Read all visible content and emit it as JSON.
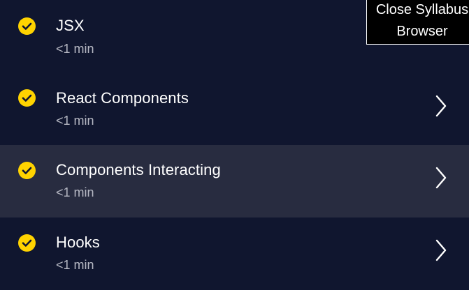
{
  "lessons": [
    {
      "title": "JSX",
      "duration": "<1 min",
      "completed": true,
      "has_chevron": false
    },
    {
      "title": "React Components",
      "duration": "<1 min",
      "completed": true,
      "has_chevron": true
    },
    {
      "title": "Components Interacting",
      "duration": "<1 min",
      "completed": true,
      "has_chevron": true,
      "highlighted": true
    },
    {
      "title": "Hooks",
      "duration": "<1 min",
      "completed": true,
      "has_chevron": true
    }
  ],
  "tooltip": {
    "line1": "Close Syllabus",
    "line2": "Browser"
  },
  "colors": {
    "background": "#10162f",
    "highlight_row": "#282c40",
    "check_yellow": "#ffd300",
    "title_text": "#ffffff",
    "duration_text": "#b6b8c3"
  },
  "icons": {
    "completed": "check-circle-icon",
    "navigate": "chevron-right-icon"
  }
}
